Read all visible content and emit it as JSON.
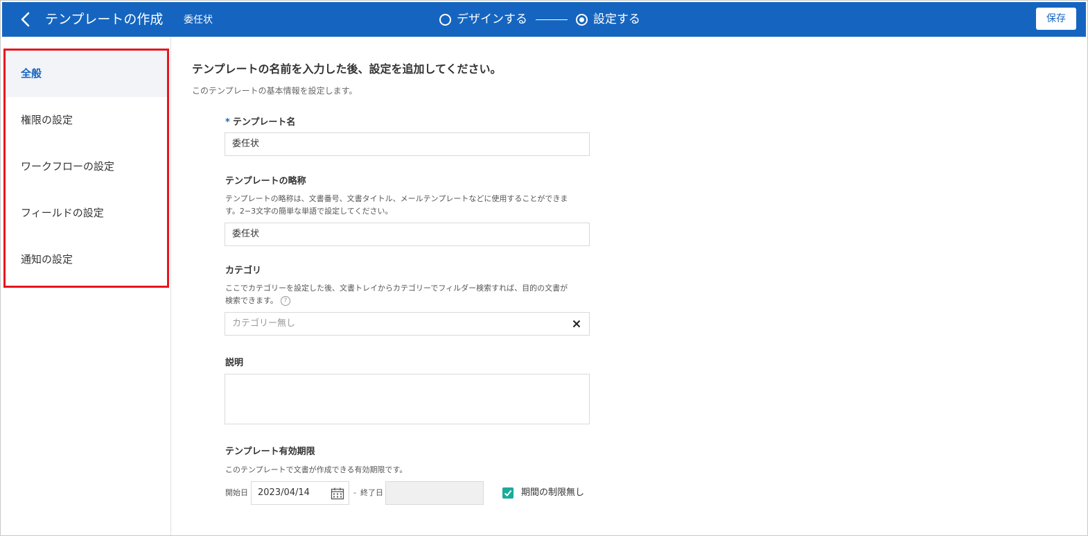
{
  "header": {
    "back_icon": "chevron-left-icon",
    "title": "テンプレートの作成",
    "document_name": "委任状",
    "steps": [
      {
        "label": "デザインする",
        "active": false
      },
      {
        "label": "設定する",
        "active": true
      }
    ],
    "save_label": "保存",
    "bar_color": "#1565c0"
  },
  "sidebar": {
    "highlight_color": "#e8141d",
    "items": [
      {
        "label": "全般",
        "active": true
      },
      {
        "label": "権限の設定",
        "active": false
      },
      {
        "label": "ワークフローの設定",
        "active": false
      },
      {
        "label": "フィールドの設定",
        "active": false
      },
      {
        "label": "通知の設定",
        "active": false
      }
    ]
  },
  "main": {
    "title": "テンプレートの名前を入力した後、設定を追加してください。",
    "subtitle": "このテンプレートの基本情報を設定します。",
    "template_name": {
      "required_mark": "*",
      "label": "テンプレート名",
      "value": "委任状"
    },
    "abbreviation": {
      "label": "テンプレートの略称",
      "help_line1": "テンプレートの略称は、文書番号、文書タイトル、メールテンプレートなどに使用することができま",
      "help_line2": "す。2−3文字の簡単な単語で設定してください。",
      "value": "委任状"
    },
    "category": {
      "label": "カテゴリ",
      "help_line1": "ここでカテゴリーを設定した後、文書トレイからカテゴリーでフィルダー検索すれば、目的の文書が",
      "help_line2": "検索できます。",
      "help_icon": "?",
      "placeholder": "カテゴリー無し",
      "clear_icon": "close-icon"
    },
    "description": {
      "label": "説明",
      "value": ""
    },
    "validity": {
      "label": "テンプレート有効期限",
      "help": "このテンプレートで文書が作成できる有効期限です。",
      "start_label": "開始日",
      "start_value": "2023/04/14",
      "separator": "-",
      "end_label": "終了日",
      "end_value": "",
      "no_limit_label": "期間の制限無し",
      "no_limit_checked": true,
      "checkbox_color": "#1aab9b"
    }
  }
}
